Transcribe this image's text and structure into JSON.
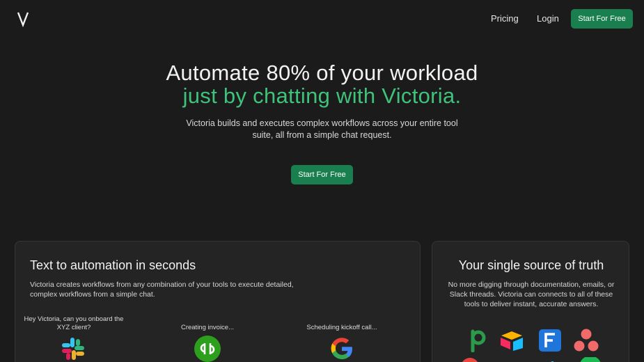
{
  "nav": {
    "logo_text": "V",
    "pricing": "Pricing",
    "login": "Login",
    "cta": "Start For Free"
  },
  "hero": {
    "headline_line1": "Automate 80% of your workload",
    "headline_line2": "just by chatting with Victoria.",
    "subtitle": "Victoria builds and executes complex workflows across your entire tool suite, all from a simple chat request.",
    "cta": "Start For Free"
  },
  "automation_card": {
    "title": "Text to automation in seconds",
    "description": "Victoria creates workflows from any combination of your tools to execute detailed, complex workflows from a simple chat.",
    "steps": [
      {
        "caption": "Hey Victoria, can you onboard the XYZ client?",
        "icon": "slack-icon"
      },
      {
        "caption": "Creating invoice...",
        "icon": "quickbooks-icon"
      },
      {
        "caption": "Scheduling kickoff call...",
        "icon": "google-icon"
      }
    ]
  },
  "truth_card": {
    "title": "Your single source of truth",
    "description": "No more digging through documentation, emails, or Slack threads. Victoria can connects to all of these tools to deliver instant, accurate answers.",
    "apps": [
      "pipedrive-icon",
      "airtable-icon",
      "freshdesk-icon",
      "asana-icon"
    ]
  },
  "colors": {
    "background": "#1b1b1b",
    "card": "#242424",
    "accent": "#3fc27a",
    "button": "#1a7f4f"
  }
}
